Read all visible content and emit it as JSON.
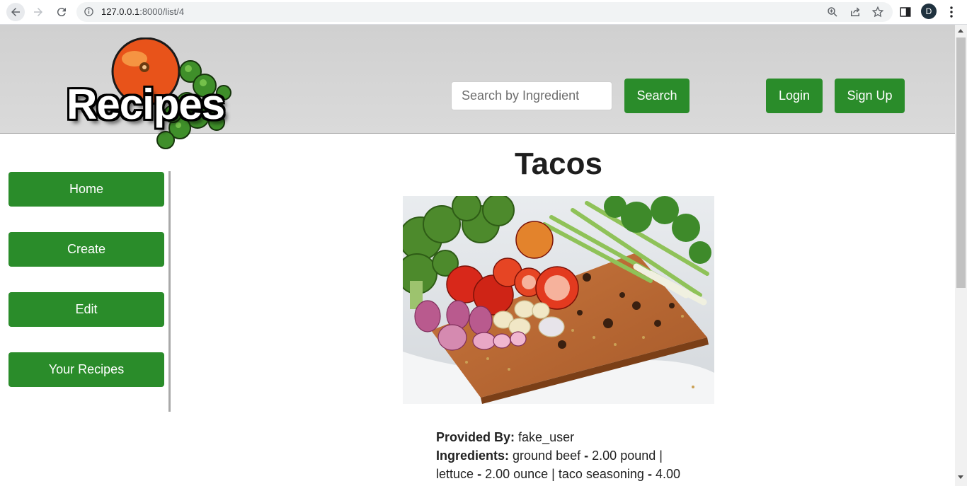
{
  "browser": {
    "url_host": "127.0.0.1",
    "url_path": ":8000/list/4",
    "profile_initial": "D"
  },
  "header": {
    "logo_text": "Recipes",
    "search_placeholder": "Search by Ingredient",
    "search_label": "Search",
    "login_label": "Login",
    "signup_label": "Sign Up",
    "accent_color": "#2a8c2a"
  },
  "sidebar": {
    "items": [
      {
        "label": "Home"
      },
      {
        "label": "Create"
      },
      {
        "label": "Edit"
      },
      {
        "label": "Your Recipes"
      }
    ]
  },
  "recipe": {
    "title": "Tacos",
    "provided_by_label": "Provided By:",
    "provided_by_value": "fake_user",
    "ingredients_label": "Ingredients:",
    "ingredients": [
      {
        "name": "ground beef",
        "amount": "2.00 pound"
      },
      {
        "name": "lettuce",
        "amount": "2.00 ounce"
      },
      {
        "name": "taco seasoning",
        "amount": "4.00"
      }
    ]
  }
}
